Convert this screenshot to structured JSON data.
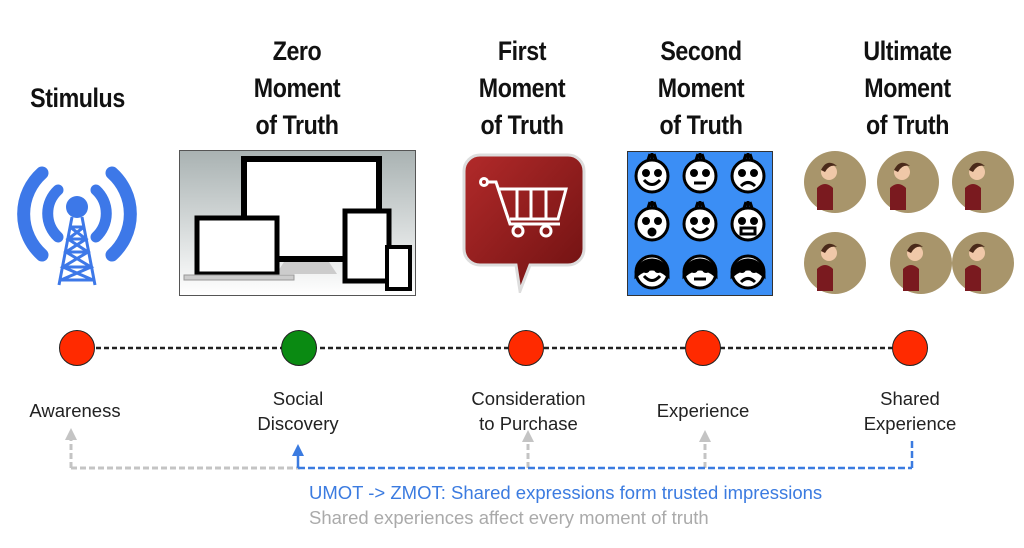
{
  "stages": [
    {
      "title": [
        "Stimulus"
      ],
      "label": [
        "Awareness"
      ],
      "node_color": "#ff2a00",
      "icon": "radio-tower-icon"
    },
    {
      "title": [
        "Zero",
        "Moment",
        "of Truth"
      ],
      "label": [
        "Social",
        "Discovery"
      ],
      "node_color": "#0a8a12",
      "icon": "devices-icon"
    },
    {
      "title": [
        "First",
        "Moment",
        "of Truth"
      ],
      "label": [
        "Consideration",
        "to Purchase"
      ],
      "node_color": "#ff2a00",
      "icon": "shopping-cart-bubble-icon"
    },
    {
      "title": [
        "Second",
        "Moment",
        "of Truth"
      ],
      "label": [
        "Experience"
      ],
      "node_color": "#ff2a00",
      "icon": "emoji-faces-grid-icon"
    },
    {
      "title": [
        "Ultimate",
        "Moment",
        "of Truth"
      ],
      "label": [
        "Shared",
        "Experience"
      ],
      "node_color": "#ff2a00",
      "icon": "woman-communicating-icon"
    }
  ],
  "notes": {
    "blue": "UMOT -> ZMOT: Shared expressions form trusted impressions",
    "gray": "Shared experiences affect every moment of truth"
  },
  "colors": {
    "blue": "#3b7be0",
    "gray": "#bdbdbd",
    "red": "#ff2a00",
    "green": "#0a8a12"
  }
}
